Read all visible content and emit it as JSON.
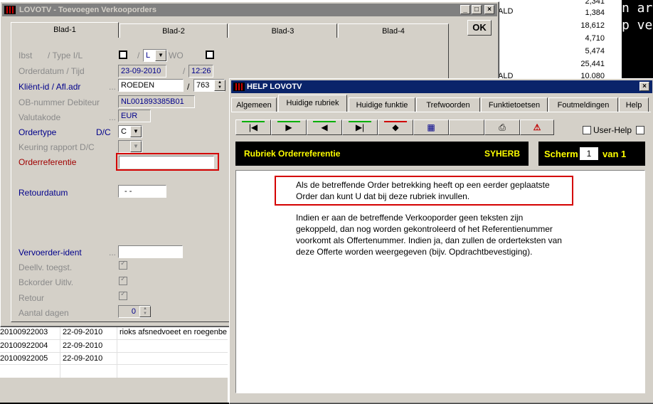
{
  "background": {
    "right_values": [
      "2,341",
      "1,384",
      "18,612",
      "4,710",
      "5,474",
      "25,441",
      "10,080"
    ],
    "ald_labels": [
      "ALD",
      "ALD",
      "ALD"
    ],
    "terminal_text": "n art\np ve",
    "rows": [
      {
        "id": "20100922003",
        "date": "22-09-2010",
        "desc": "rioks afsnedvoeet   en roegenbe"
      },
      {
        "id": "20100922004",
        "date": "22-09-2010",
        "desc": ""
      },
      {
        "id": "20100922005",
        "date": "22-09-2010",
        "desc": ""
      }
    ]
  },
  "main_window": {
    "title": "LOVOTV - Toevoegen Verkooporders",
    "tabs": [
      "Blad-1",
      "Blad-2",
      "Blad-3",
      "Blad-4"
    ],
    "ok_label": "OK",
    "fields": {
      "ibst_label": "Ibst",
      "type_label": "/ Type I/L",
      "slash": "/",
      "type_value": "L",
      "wo_label": "WO",
      "orderdatum_label": "Orderdatum / Tijd",
      "orderdatum_value": "23-09-2010",
      "tijd_value": "12:26",
      "klient_label": "Kliënt-id / Afl.adr",
      "klient_dots": "...",
      "klient_value": "ROEDEN",
      "afl_value": "763",
      "ob_label": "OB-nummer Debiteur",
      "ob_value": "NL001893385B01",
      "valuta_label": "Valutakode",
      "valuta_dots": "...",
      "valuta_value": "EUR",
      "ordertype_label": "Ordertype",
      "dc_label": "D/C",
      "ordertype_value": "C",
      "keuring_label": "Keuring rapport D/C",
      "orderref_label": "Orderreferentie",
      "orderref_value": "",
      "retour_label": "Retourdatum",
      "retour_value": "- -",
      "vervoerder_label": "Vervoerder-ident",
      "vervoerder_dots": "...",
      "vervoerder_value": "",
      "deellv_label": "Deellv. toegst.",
      "bckorder_label": "Bckorder Uitlv.",
      "retour2_label": "Retour",
      "aantal_label": "Aantal dagen",
      "aantal_value": "0"
    }
  },
  "help_window": {
    "title": "HELP LOVOTV",
    "tabs": [
      "Algemeen",
      "Huidige rubriek",
      "Huidige funktie",
      "Trefwoorden",
      "Funktietoetsen",
      "Foutmeldingen",
      "Help"
    ],
    "active_tab": "Huidige rubriek",
    "user_help_label": "User-Help",
    "rubriek_title": "Rubriek Orderreferentie",
    "rubriek_code": "SYHERB",
    "scherm_label": "Scherm",
    "scherm_value": "1",
    "scherm_van": "van 1",
    "paragraph1_line1": "Als de betreffende Order betrekking heeft op een eerder geplaatste",
    "paragraph1_line2": "Order dan kunt U dat bij deze rubriek invullen.",
    "paragraph2_lines": [
      "Indien er aan de betreffende Verkooporder geen teksten zijn",
      "gekoppeld, dan nog worden gekontroleerd of het Referentienummer",
      "voorkomt als Offertenummer. Indien ja, dan zullen de orderteksten van",
      "deze Offerte worden weergegeven (bijv. Opdrachtbevestiging)."
    ]
  },
  "colors": {
    "highlight": "#d40000",
    "active_title": "#0a246a",
    "inactive_title": "#808080",
    "label_blue": "#00008b",
    "label_red": "#a00000",
    "panel_text": "#ffff00"
  }
}
